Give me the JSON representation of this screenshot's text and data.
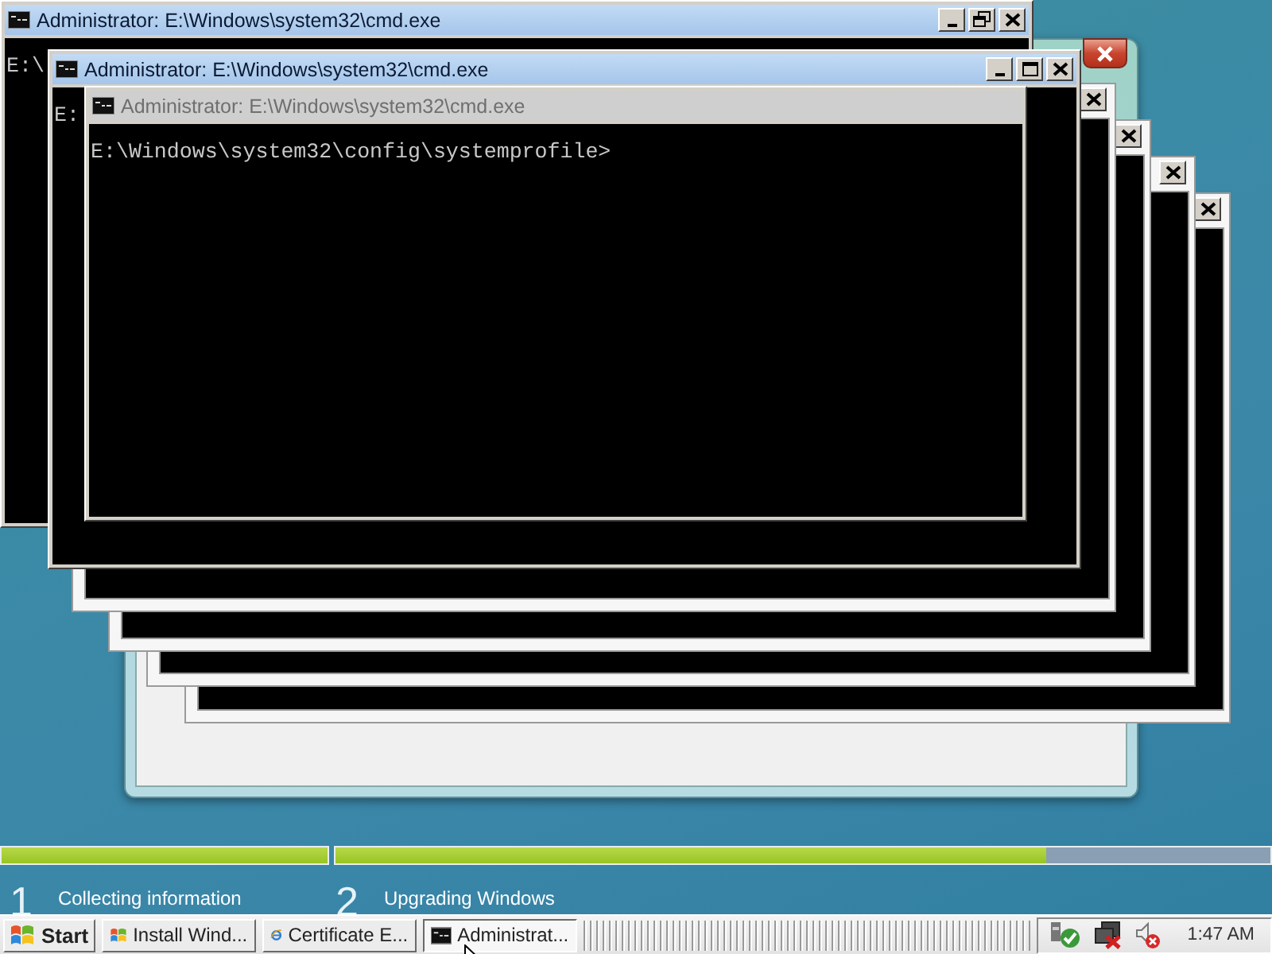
{
  "windows": [
    {
      "kind": "setup"
    },
    {
      "kind": "ghost"
    },
    {
      "kind": "ghost"
    },
    {
      "kind": "ghost"
    },
    {
      "kind": "ghost"
    },
    {
      "kind": "console",
      "title": "Administrator: E:\\Windows\\system32\\cmd.exe",
      "active": true,
      "maximized": true,
      "caption_buttons": true,
      "lines": [
        "E:\\"
      ]
    },
    {
      "kind": "console",
      "title": "Administrator: E:\\Windows\\system32\\cmd.exe",
      "active": true,
      "maximized": false,
      "caption_buttons": true,
      "lines": [
        "E:"
      ]
    },
    {
      "kind": "console",
      "title": "Administrator: E:\\Windows\\system32\\cmd.exe",
      "active": false,
      "caption_buttons": false,
      "lines": [
        "E:\\Windows\\system32\\config\\systemprofile>"
      ]
    }
  ],
  "setup_progress": {
    "segments": [
      {
        "level": 1
      },
      {
        "level": 0.76
      }
    ],
    "steps": [
      {
        "number": "1",
        "label": "Collecting information"
      },
      {
        "number": "2",
        "label": "Upgrading Windows"
      }
    ]
  },
  "taskbar": {
    "start": "Start",
    "tasks": [
      {
        "kind": "setup",
        "label": "Install Wind...",
        "selected": false
      },
      {
        "kind": "browser",
        "label": "Certificate E...",
        "selected": false
      },
      {
        "kind": "console",
        "label": "Administrat...",
        "selected": true
      }
    ],
    "clock": "1:47 AM"
  }
}
